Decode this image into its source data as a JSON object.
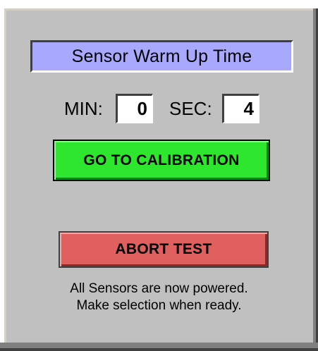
{
  "panel": {
    "title": "Sensor Warm Up Time",
    "min_label": "MIN:",
    "min_value": "0",
    "sec_label": "SEC:",
    "sec_value": "4",
    "calibration_button": "GO TO CALIBRATION",
    "abort_button": "ABORT TEST",
    "status_line_1": "All Sensors are now powered.",
    "status_line_2": "Make selection when ready."
  },
  "colors": {
    "panel_bg": "#c0c0c0",
    "title_bg": "#a8a8ff",
    "calibration_button_bg": "#2ee62e",
    "abort_button_bg": "#e06060"
  }
}
